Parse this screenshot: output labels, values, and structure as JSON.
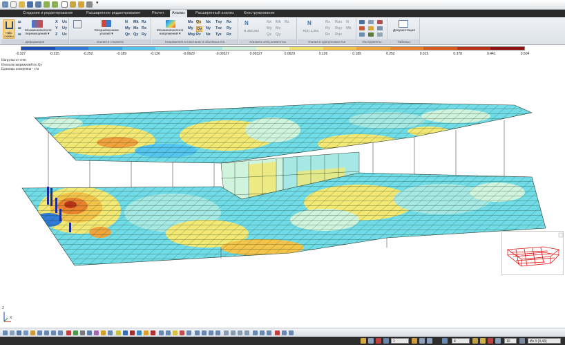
{
  "menu": {
    "tabs": [
      {
        "label": "Создание и редактирование",
        "active": false
      },
      {
        "label": "Расширенное редактирование",
        "active": false
      },
      {
        "label": "Расчет",
        "active": false
      },
      {
        "label": "Анализ",
        "active": true
      },
      {
        "label": "Расширенный анализ",
        "active": false
      },
      {
        "label": "Конструирование",
        "active": false
      }
    ]
  },
  "ribbon": {
    "groups": [
      {
        "label": "Деформации"
      },
      {
        "label": "Усилия в стержнях"
      },
      {
        "label": "Напряжения в пластинах и объемных КЭ"
      },
      {
        "label": "Усилия в спец.элементах"
      },
      {
        "label": "Усилия в одноузловых КЭ"
      },
      {
        "label": "Инструменты"
      },
      {
        "label": "Таблицы"
      }
    ],
    "buttons": {
      "ndc_label": "НДС\nсхемы",
      "iso_disp_label": "Мозаика/изополя\nперемещений",
      "epure_label": "Эпюры/мозаика\nусилий",
      "iso_stress_label": "Мозаика/изополя\nнапряжений",
      "spec_value": "N 252,262",
      "onenode_value": "R(Z) 1,251",
      "docs_label": "Документация"
    }
  },
  "legend": {
    "colors": [
      "#1c4fb5",
      "#2f7ad6",
      "#3aa3e8",
      "#53c5f0",
      "#7ad9ee",
      "#a6e8e4",
      "#cff3dc",
      "#f4f7b8",
      "#f3e36a",
      "#f4c44a",
      "#f0a43c",
      "#e8822c",
      "#d85a1c",
      "#bb3216",
      "#8e1010"
    ],
    "ticks": [
      "-0.327",
      "-0.315",
      "-0.252",
      "-0.189",
      "-0.126",
      "-0.0629",
      "-0.00327",
      "0.00327",
      "0.0629",
      "0.126",
      "0.189",
      "0.252",
      "0.315",
      "0.378",
      "0.441",
      "0.504"
    ]
  },
  "info": {
    "line1": "Нагрузка от стен",
    "line2": "Изополя напряжений по Qy",
    "line3": "Единицы измерения - т/м"
  },
  "axes": {
    "z": "Z",
    "x": "X"
  },
  "status": {
    "load_case": "1",
    "num_field": "4",
    "scale": "10",
    "zoom": "Из 3 (0,43)"
  }
}
